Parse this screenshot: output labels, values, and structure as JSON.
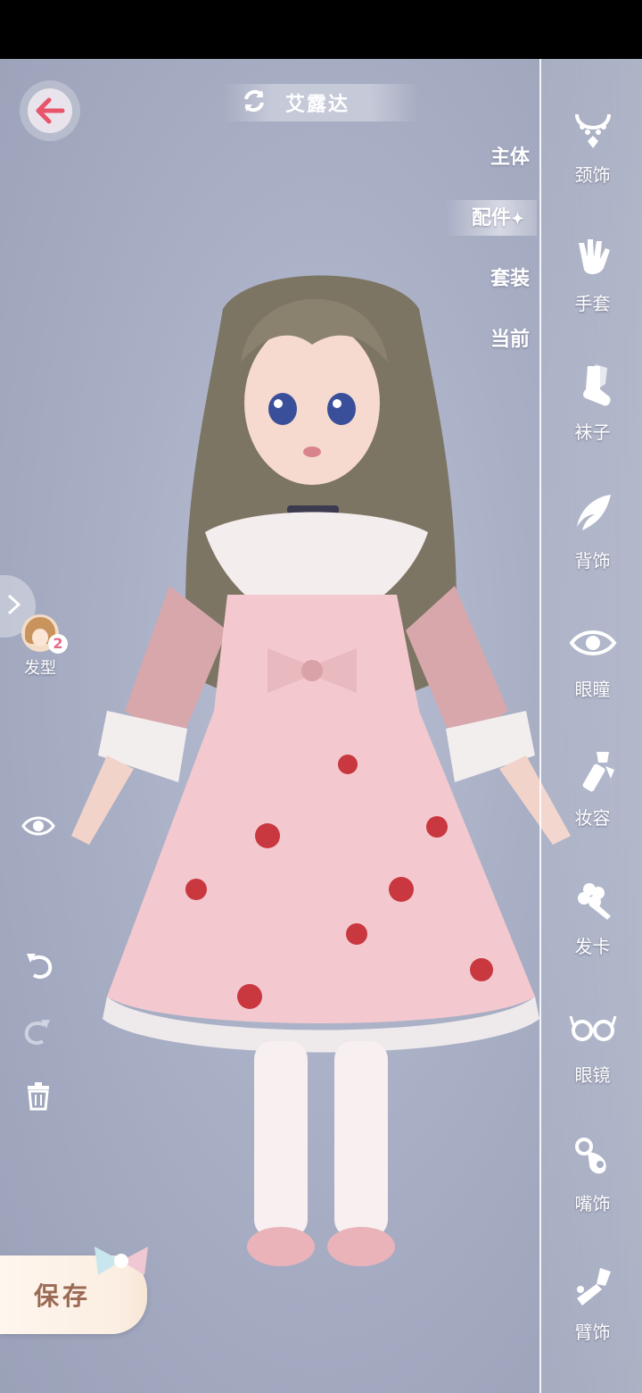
{
  "header": {
    "character_name": "艾露达"
  },
  "tabs": [
    {
      "label": "主体",
      "active": false
    },
    {
      "label": "配件",
      "active": true
    },
    {
      "label": "套装",
      "active": false
    },
    {
      "label": "当前",
      "active": false
    }
  ],
  "rail": {
    "items": [
      {
        "label": "颈饰",
        "icon": "necklace-icon"
      },
      {
        "label": "手套",
        "icon": "glove-icon"
      },
      {
        "label": "袜子",
        "icon": "sock-icon"
      },
      {
        "label": "背饰",
        "icon": "wing-icon"
      },
      {
        "label": "眼瞳",
        "icon": "eye-icon"
      },
      {
        "label": "妆容",
        "icon": "makeup-icon"
      },
      {
        "label": "发卡",
        "icon": "hairclip-icon"
      },
      {
        "label": "眼镜",
        "icon": "glasses-icon"
      },
      {
        "label": "嘴饰",
        "icon": "pacifier-icon"
      },
      {
        "label": "臂饰",
        "icon": "armband-icon"
      }
    ]
  },
  "left_panel": {
    "hair_label": "发型",
    "hair_badge": "2"
  },
  "save": {
    "label": "保存"
  },
  "colors": {
    "background": "#a9afc5",
    "rail_border": "#ffffff",
    "save_text": "#9a6a55",
    "dress_pink": "#f3c9cf"
  }
}
